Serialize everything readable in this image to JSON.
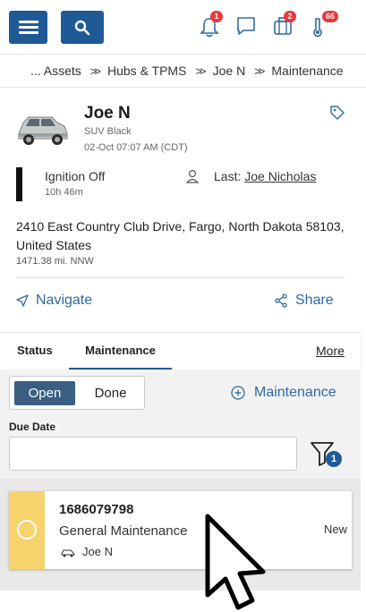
{
  "topbar": {
    "menu_icon": "hamburger-icon",
    "search_icon": "search-icon",
    "alerts_badge": "1",
    "messages_icon": "chat-icon",
    "tasks_badge": "2",
    "notices_badge": "66",
    "accent": "#1f5a96",
    "badge_color": "#e5383b"
  },
  "breadcrumb": {
    "items": [
      "... Assets",
      "Hubs & TPMS",
      "Joe N",
      "Maintenance"
    ]
  },
  "vehicle": {
    "name": "Joe N",
    "type": "SUV Black",
    "timestamp": "02-Oct 07:07 AM (CDT)",
    "ignition": "Ignition Off",
    "ignition_duration": "10h 46m",
    "last_label": "Last:",
    "last_driver": "Joe Nicholas",
    "address": "2410 East Country Club Drive, Fargo, North Dakota 58103, United States",
    "distance": "1471.38 mi. NNW",
    "navigate": "Navigate",
    "share": "Share"
  },
  "tabs": {
    "status": "Status",
    "maintenance": "Maintenance",
    "more": "More"
  },
  "maintenance": {
    "open": "Open",
    "done": "Done",
    "add_label": "Maintenance",
    "due_label": "Due Date",
    "due_value": "",
    "filter_count": "1",
    "items": [
      {
        "id": "1686079798",
        "type": "General Maintenance",
        "vehicle": "Joe N",
        "status": "New",
        "stripe_color": "#f6d36c"
      }
    ]
  }
}
